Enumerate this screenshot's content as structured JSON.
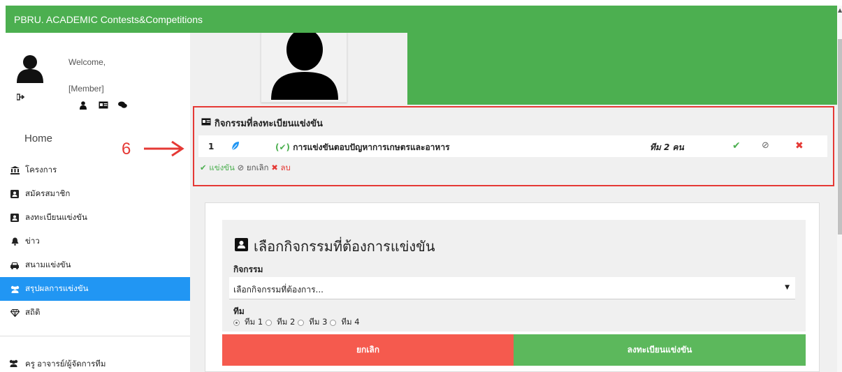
{
  "header": {
    "title": "PBRU. ACADEMIC Contests&Competitions"
  },
  "user": {
    "welcome": "Welcome,",
    "member": "[Member]"
  },
  "sidebar": {
    "home": "Home",
    "items": [
      {
        "label": "โครงการ",
        "icon": "bank-icon",
        "active": false
      },
      {
        "label": "สมัครสมาชิก",
        "icon": "user-plus-icon",
        "active": false
      },
      {
        "label": "ลงทะเบียนแข่งขัน",
        "icon": "user-square-icon",
        "active": false
      },
      {
        "label": "ข่าว",
        "icon": "bell-icon",
        "active": false
      },
      {
        "label": "สนามแข่งขัน",
        "icon": "car-icon",
        "active": false
      },
      {
        "label": "สรุปผลการแข่งขัน",
        "icon": "users-icon",
        "active": true
      },
      {
        "label": "สถิติ",
        "icon": "diamond-icon",
        "active": false
      }
    ],
    "teacher": "ครู อาจารย์/ผู้จัดการทีม"
  },
  "registered": {
    "title": "กิจกรรมที่ลงทะเบียนแข่งขัน",
    "rows": [
      {
        "num": "1",
        "check": "(✔)",
        "competition": "การแข่งขันตอบปัญหาการเกษตรและอาหาร",
        "team": "ทีม 2 คน"
      }
    ],
    "legend": {
      "compete": "แข่งขัน",
      "cancel": "ยกเลิก",
      "delete": "ลบ"
    }
  },
  "annotation": {
    "number": "6"
  },
  "form": {
    "title": "เลือกกิจกรรมที่ต้องการแข่งขัน",
    "activity_label": "กิจกรรม",
    "activity_value": "เลือกกิจกรรมที่ต้องการ...",
    "team_label": "ทีม",
    "teams": [
      "ทีม 1",
      "ทีม 2",
      "ทีม 3",
      "ทีม 4"
    ],
    "selected_team": "ทีม 1",
    "cancel_label": "ยกเลิก",
    "register_label": "ลงทะเบียนแข่งขัน"
  },
  "colors": {
    "header_green": "#4caf50",
    "active_blue": "#2196f3",
    "cancel_red": "#f55a4e",
    "register_green": "#5cb85c",
    "annotation_red": "#e53935"
  }
}
